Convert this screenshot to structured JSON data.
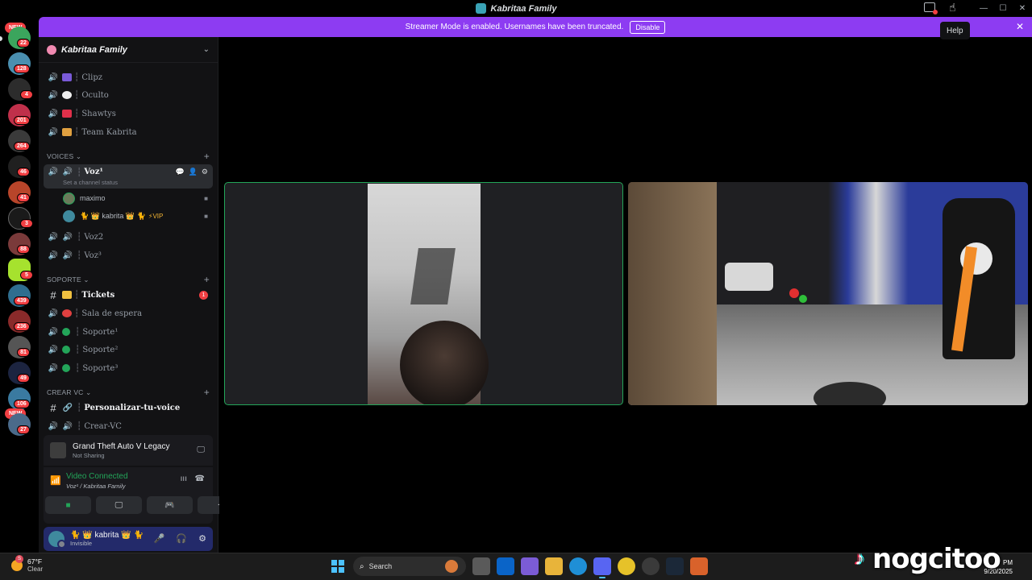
{
  "window": {
    "title": "Kabritaa Family",
    "help_tooltip": "Help"
  },
  "banner": {
    "message": "Streamer Mode is enabled. Usernames have been truncated.",
    "disable_label": "Disable"
  },
  "rail": {
    "badges": [
      "22",
      "128",
      "4",
      "201",
      "264",
      "46",
      "41",
      "3",
      "88",
      "5",
      "439",
      "236",
      "81",
      "49",
      "106",
      "27"
    ],
    "new_labels": [
      "NEW",
      "NEW"
    ]
  },
  "server": {
    "name": "Kabritaa Family",
    "top_channels": [
      "Clipz",
      "Oculto",
      "Shawtys",
      "Team Kabrita"
    ],
    "categories": {
      "voices": "VOICES",
      "soporte": "SOPORTE",
      "crear": "CREAR VC"
    },
    "voice_active": {
      "name": "Voz¹",
      "status_placeholder": "Set a channel status"
    },
    "voice_users": [
      {
        "name": "maximo"
      },
      {
        "name": "🐈 👑 kabrita 👑 🐈",
        "badge": "⚡VIP"
      }
    ],
    "voice_channels": [
      "Voz2",
      "Voz³"
    ],
    "soporte_channels": [
      {
        "name": "Tickets",
        "unread": "1"
      },
      {
        "name": "Sala de espera"
      },
      {
        "name": "Soporte¹"
      },
      {
        "name": "Soporte²"
      },
      {
        "name": "Soporte³"
      }
    ],
    "crear_channels": [
      "Personalizar-tu-voice",
      "Crear-VC"
    ]
  },
  "activity": {
    "game": "Grand Theft Auto V Legacy",
    "status": "Not Sharing"
  },
  "rtc": {
    "state": "Video Connected",
    "location": "Voz¹ / Kabritaa Family"
  },
  "user": {
    "name": "🐈 👑 kabrita 👑 🐈",
    "status": "Invisible"
  },
  "taskbar": {
    "temperature": "67°F",
    "condition": "Clear",
    "search_placeholder": "Search",
    "time": "PM",
    "date": "9/20/2025"
  },
  "watermark": {
    "text": "nogcitoo"
  },
  "colors": {
    "accent": "#8d3cf2",
    "speaking": "#23a559",
    "unread": "#f23f43",
    "userbar": "#232a6a"
  }
}
